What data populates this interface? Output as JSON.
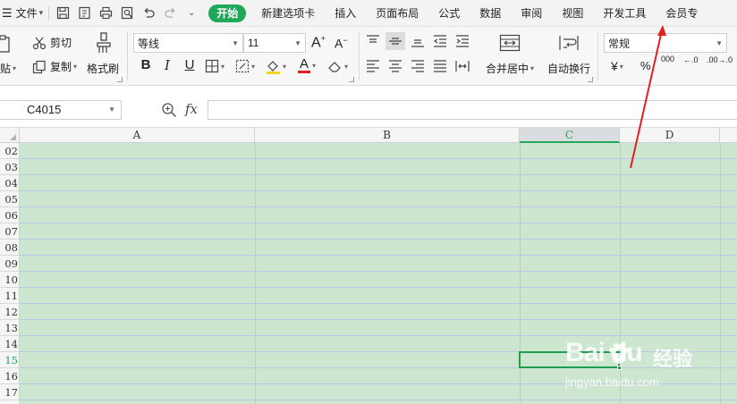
{
  "menubar": {
    "file_label": "文件",
    "tabs": [
      "开始",
      "新建选项卡",
      "插入",
      "页面布局",
      "公式",
      "数据",
      "审阅",
      "视图",
      "开发工具",
      "会员专"
    ]
  },
  "ribbon": {
    "paste_label": "粘贴",
    "cut_label": "剪切",
    "copy_label": "复制",
    "format_painter_label": "格式刷",
    "font_name": "等线",
    "font_size": "11",
    "merge_center_label": "合并居中",
    "wrap_text_label": "自动换行",
    "number_format": "常规",
    "number_buttons": [
      "¥",
      "%",
      "000",
      "←.0",
      ".00→.0"
    ]
  },
  "formula_bar": {
    "cell_reference": "C4015",
    "fx_label": "fx",
    "formula_value": ""
  },
  "grid": {
    "columns": [
      "A",
      "B",
      "C",
      "D"
    ],
    "selected_column": "C",
    "rows": [
      "02",
      "03",
      "04",
      "05",
      "06",
      "07",
      "08",
      "09",
      "10",
      "11",
      "12",
      "13",
      "14",
      "15",
      "16",
      "17"
    ],
    "selected_row": "15",
    "fill_color": "#cde6cf"
  },
  "annotation": {
    "arrow_color": "#e02020",
    "points_to": "开发工具"
  },
  "watermark": {
    "brand": "Bai du",
    "brand_cn": "经验",
    "url": "jingyan.baidu.com"
  },
  "colors": {
    "accent": "#1fa75a",
    "grid_line": "#b9c8e6"
  }
}
